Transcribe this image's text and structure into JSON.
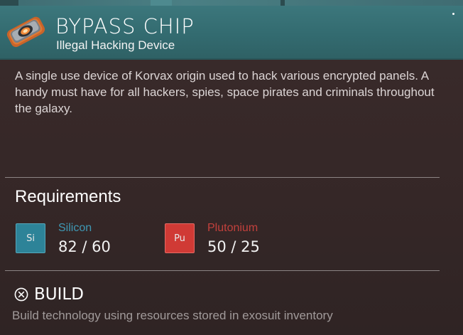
{
  "item": {
    "title": "BYPASS CHIP",
    "subtitle": "Illegal Hacking Device",
    "icon": "bypass-chip-icon",
    "description": "A single use device of Korvax origin used to hack various encrypted panels. A handy must have for all hackers, spies, space pirates and criminals throughout the galaxy."
  },
  "requirements": {
    "heading": "Requirements",
    "resources": [
      {
        "symbol": "Si",
        "name": "Silicon",
        "amount": "82 / 60",
        "color": "#2f8aa0",
        "name_color": "#3f98b4"
      },
      {
        "symbol": "Pu",
        "name": "Plutonium",
        "amount": "50 / 25",
        "color": "#d23a36",
        "name_color": "#c2403c"
      }
    ]
  },
  "build": {
    "icon": "cross-circle-icon",
    "label": "BUILD",
    "description": "Build technology using resources stored in exosuit inventory"
  },
  "colors": {
    "header": "#3a7479",
    "panel": "#372929"
  }
}
